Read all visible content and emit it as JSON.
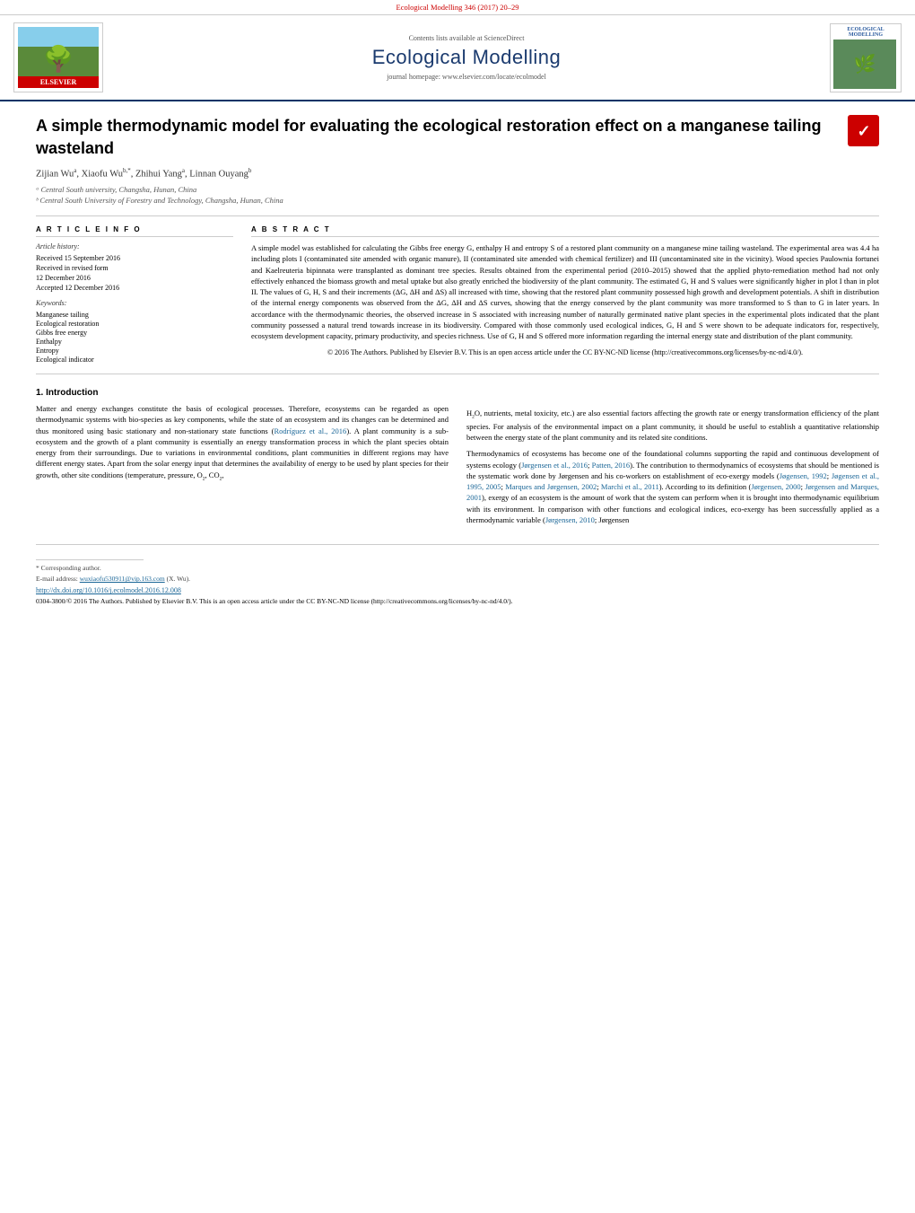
{
  "banner": {
    "text": "Ecological Modelling 346 (2017) 20–29"
  },
  "journal_header": {
    "sciencedirect_text": "Contents lists available at ScienceDirect",
    "sciencedirect_link": "ScienceDirect",
    "title": "Ecological Modelling",
    "homepage_text": "journal homepage: www.elsevier.com/locate/ecolmodel",
    "homepage_link": "www.elsevier.com/locate/ecolmodel",
    "elsevier_label": "ELSEVIER",
    "ecological_modelling_label": "ECOLOGICAL MODELLING"
  },
  "paper": {
    "title": "A simple thermodynamic model for evaluating the ecological restoration effect on a manganese tailing wasteland",
    "authors": "Zijian Wuᵃ, Xiaofu Wuᵇ,*, Zhihui Yangᵃ, Linnan Ouyangᵇ",
    "affiliation_a": "ᵃ Central South university, Changsha, Hunan, China",
    "affiliation_b": "ᵇ Central South University of Forestry and Technology, Changsha, Hunan, China",
    "article_info": {
      "heading": "A R T I C L E   I N F O",
      "history_label": "Article history:",
      "received": "Received 15 September 2016",
      "revised": "Received in revised form 12 December 2016",
      "accepted": "Accepted 12 December 2016",
      "keywords_label": "Keywords:",
      "keywords": [
        "Manganese tailing",
        "Ecological restoration",
        "Gibbs free energy",
        "Enthalpy",
        "Entropy",
        "Ecological indicator"
      ]
    },
    "abstract": {
      "heading": "A B S T R A C T",
      "text": "A simple model was established for calculating the Gibbs free energy G, enthalpy H and entropy S of a restored plant community on a manganese mine tailing wasteland. The experimental area was 4.4 ha including plots I (contaminated site amended with organic manure), II (contaminated site amended with chemical fertilizer) and III (uncontaminated site in the vicinity). Wood species Paulownia fortunei and Kaelreuteria bipinnata were transplanted as dominant tree species. Results obtained from the experimental period (2010–2015) showed that the applied phyto-remediation method had not only effectively enhanced the biomass growth and metal uptake but also greatly enriched the biodiversity of the plant community. The estimated G, H and S values were significantly higher in plot I than in plot II. The values of G, H, S and their increments (ΔG, ΔH and ΔS) all increased with time, showing that the restored plant community possessed high growth and development potentials. A shift in distribution of the internal energy components was observed from the ΔG, ΔH and ΔS curves, showing that the energy conserved by the plant community was more transformed to S than to G in later years. In accordance with the thermodynamic theories, the observed increase in S associated with increasing number of naturally germinated native plant species in the experimental plots indicated that the plant community possessed a natural trend towards increase in its biodiversity. Compared with those commonly used ecological indices, G, H and S were shown to be adequate indicators for, respectively, ecosystem development capacity, primary productivity, and species richness. Use of G, H and S offered more information regarding the internal energy state and distribution of the plant community.",
      "copyright": "© 2016 The Authors. Published by Elsevier B.V. This is an open access article under the CC BY-NC-ND license (http://creativecommons.org/licenses/by-nc-nd/4.0/)."
    }
  },
  "introduction": {
    "heading": "1.  Introduction",
    "col1_p1": "Matter and energy exchanges constitute the basis of ecological processes. Therefore, ecosystems can be regarded as open thermodynamic systems with bio-species as key components, while the state of an ecosystem and its changes can be determined and thus monitored using basic stationary and non-stationary state functions (Rodríguez et al., 2016). A plant community is a sub-ecosystem and the growth of a plant community is essentially an energy transformation process in which the plant species obtain energy from their surroundings. Due to variations in environmental conditions, plant communities in different regions may have different energy states. Apart from the solar energy input that determines the availability of energy to be used by plant species for their growth, other site conditions (temperature, pressure, O₂, CO₂,",
    "col2_p1": "H₂O, nutrients, metal toxicity, etc.) are also essential factors affecting the growth rate or energy transformation efficiency of the plant species. For analysis of the environmental impact on a plant community, it should be useful to establish a quantitative relationship between the energy state of the plant community and its related site conditions.",
    "col2_p2": "Thermodynamics of ecosystems has become one of the foundational columns supporting the rapid and continuous development of systems ecology (Jørgensen et al., 2016; Patten, 2016). The contribution to thermodynamics of ecosystems that should be mentioned is the systematic work done by Jørgensen and his co-workers on establishment of eco-exergy models (Jøgensen, 1992; Jøgensen et al., 1995, 2005; Marques and Jørgensen, 2002; Marchi et al., 2011). According to its definition (Jørgensen, 2000; Jørgensen and Marques, 2001), exergy of an ecosystem is the amount of work that the system can perform when it is brought into thermodynamic equilibrium with its environment. In comparison with other functions and ecological indices, eco-exergy has been successfully applied as a thermodynamic variable (Jørgensen, 2010; Jørgensen"
  },
  "footer": {
    "corresponding_note": "* Corresponding author.",
    "email_label": "E-mail address:",
    "email": "wuxiaofu530911@vip.163.com",
    "email_suffix": " (X. Wu).",
    "doi": "http://dx.doi.org/10.1016/j.ecolmodel.2016.12.008",
    "license_text": "0304-3800/© 2016 The Authors. Published by Elsevier B.V. This is an open access article under the CC BY-NC-ND license (http://creativecommons.org/licenses/by-nc-nd/4.0/)."
  },
  "icons": {
    "crossmark": "✕",
    "tree": "🌳"
  }
}
